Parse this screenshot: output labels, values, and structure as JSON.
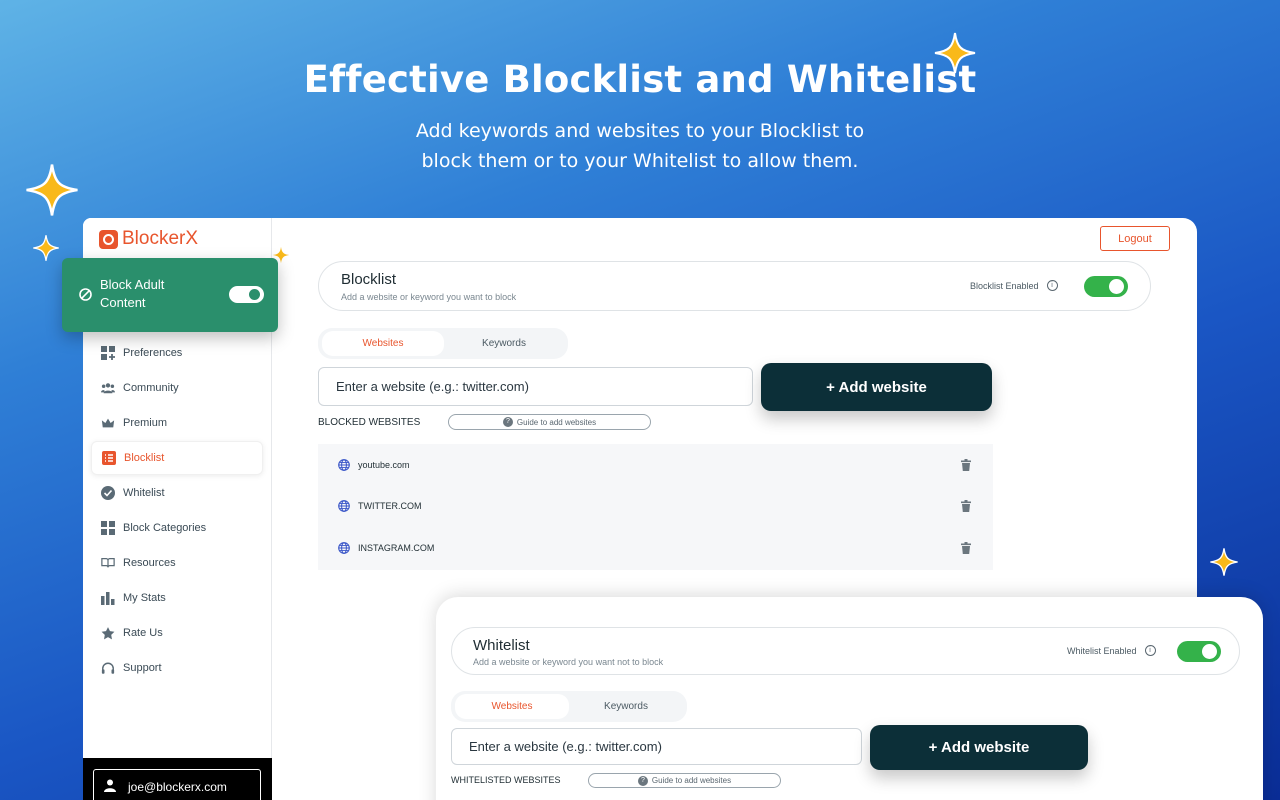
{
  "hero": {
    "title": "Effective Blocklist and Whitelist",
    "subtitle_line1": "Add keywords and websites to your Blocklist to",
    "subtitle_line2": "block them or to your Whitelist to allow them."
  },
  "brand": {
    "name": "BlockerX",
    "accent": "#e8552d"
  },
  "block_adult": {
    "label_line1": "Block Adult",
    "label_line2": "Content",
    "enabled": true
  },
  "sidebar": {
    "items": [
      {
        "label": "Preferences",
        "icon": "preferences-icon"
      },
      {
        "label": "Community",
        "icon": "community-icon"
      },
      {
        "label": "Premium",
        "icon": "crown-icon"
      },
      {
        "label": "Blocklist",
        "icon": "list-icon",
        "active": true
      },
      {
        "label": "Whitelist",
        "icon": "check-circle-icon"
      },
      {
        "label": "Block Categories",
        "icon": "grid-icon"
      },
      {
        "label": "Resources",
        "icon": "book-icon"
      },
      {
        "label": "My Stats",
        "icon": "bar-chart-icon"
      },
      {
        "label": "Rate Us",
        "icon": "star-icon"
      },
      {
        "label": "Support",
        "icon": "headset-icon"
      }
    ],
    "user_email": "joe@blockerx.com"
  },
  "header": {
    "logout_label": "Logout"
  },
  "blocklist": {
    "title": "Blocklist",
    "subtitle": "Add a website or keyword you want to block",
    "enabled_label": "Blocklist Enabled",
    "tabs": [
      "Websites",
      "Keywords"
    ],
    "input_placeholder": "Enter a website (e.g.: twitter.com)",
    "add_button": "+ Add website",
    "section_label": "BLOCKED WEBSITES",
    "guide_label": "Guide to add websites",
    "sites": [
      "youtube.com",
      "TWITTER.COM",
      "INSTAGRAM.COM"
    ]
  },
  "whitelist": {
    "title": "Whitelist",
    "subtitle": "Add a website or keyword you want not to block",
    "enabled_label": "Whitelist Enabled",
    "tabs": [
      "Websites",
      "Keywords"
    ],
    "input_placeholder": "Enter a website (e.g.: twitter.com)",
    "add_button": "+ Add website",
    "section_label": "WHITELISTED WEBSITES",
    "guide_label": "Guide to add websites"
  },
  "colors": {
    "toggle_on": "#34b24a",
    "primary_button": "#0c2f38",
    "green_card": "#2a8f6c"
  }
}
